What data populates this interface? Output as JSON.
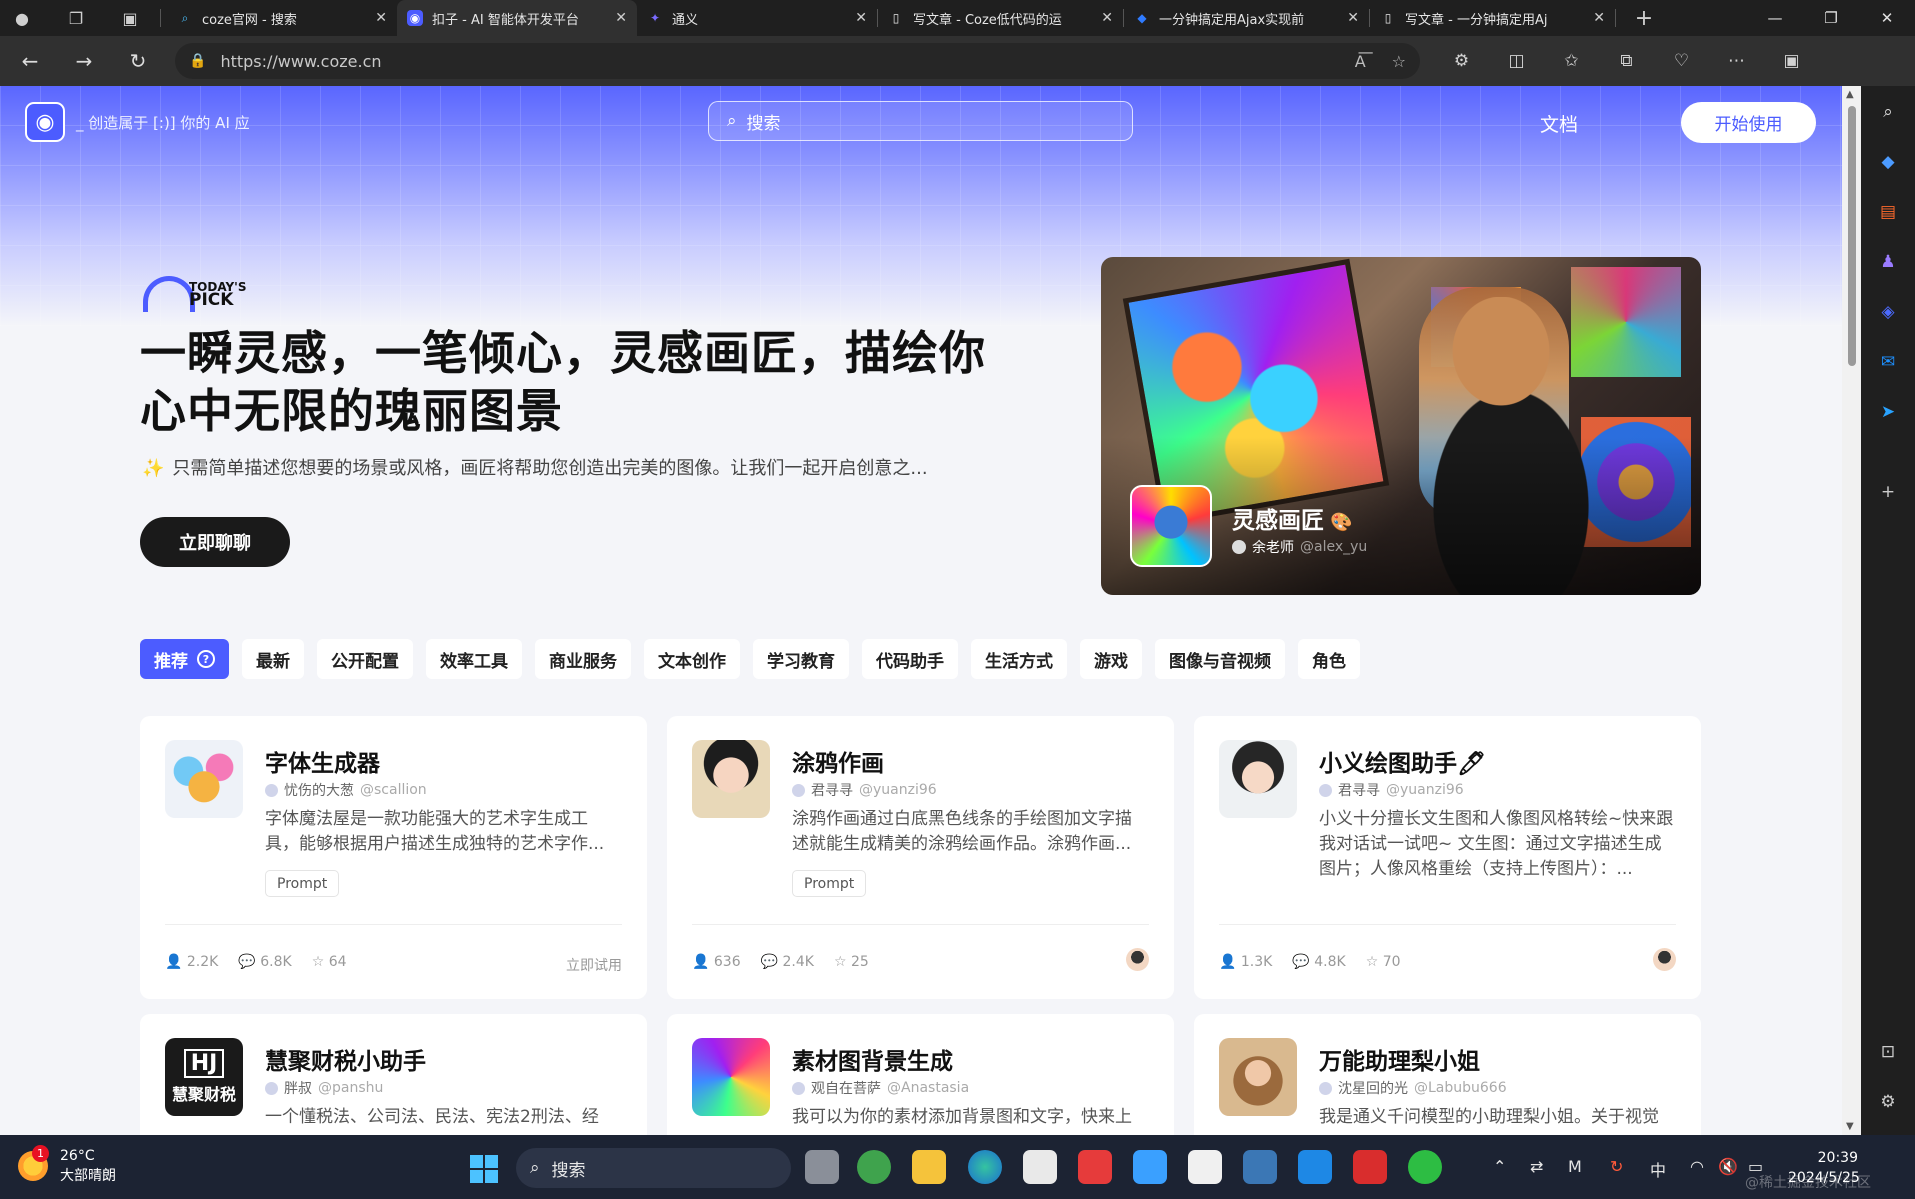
{
  "browser": {
    "tabs": [
      {
        "label": "coze官网 - 搜索",
        "icon": "search-icon"
      },
      {
        "label": "扣子 - AI 智能体开发平台",
        "icon": "coze-icon",
        "active": true
      },
      {
        "label": "通义",
        "icon": "tongyi-icon"
      },
      {
        "label": "写文章 - Coze低代码的运",
        "icon": "document-icon"
      },
      {
        "label": "一分钟搞定用Ajax实现前",
        "icon": "juejin-icon"
      },
      {
        "label": "写文章 - 一分钟搞定用Aj",
        "icon": "document-icon"
      }
    ],
    "url": "https://www.coze.cn"
  },
  "header": {
    "logo_text": "_ 创造属于 [:)] 你的 AI 应",
    "search_placeholder": "搜索",
    "docs_link": "文档",
    "start_button": "开始使用"
  },
  "hero": {
    "pick_small": "TODAY'S",
    "pick_big": "PICK",
    "title": "一瞬灵感，一笔倾心，灵感画匠，描绘你心中无限的瑰丽图景",
    "subtitle": "只需简单描述您想要的场景或风格，画匠将帮助您创造出完美的图像。让我们一起开启创意之...",
    "subtitle_icon": "✨",
    "chat_button": "立即聊聊",
    "bot_name": "灵感画匠",
    "bot_emoji": "🎨",
    "bot_author": "余老师",
    "bot_handle": "@alex_yu"
  },
  "categories": [
    "推荐",
    "最新",
    "公开配置",
    "效率工具",
    "商业服务",
    "文本创作",
    "学习教育",
    "代码助手",
    "生活方式",
    "游戏",
    "图像与音视频",
    "角色"
  ],
  "cards": [
    {
      "title": "字体生成器",
      "author": "忧伤的大葱",
      "handle": "@scallion",
      "desc": "字体魔法屋是一款功能强大的艺术字生成工具，能够根据用户描述生成独特的艺术字作...",
      "tag": "Prompt",
      "users": "2.2K",
      "chats": "6.8K",
      "stars": "64",
      "try": "立即试用"
    },
    {
      "title": "涂鸦作画",
      "author": "君寻寻",
      "handle": "@yuanzi96",
      "desc": "涂鸦作画通过白底黑色线条的手绘图加文字描述就能生成精美的涂鸦绘画作品。涂鸦作画...",
      "tag": "Prompt",
      "users": "636",
      "chats": "2.4K",
      "stars": "25"
    },
    {
      "title": "小义绘图助手🖊",
      "author": "君寻寻",
      "handle": "@yuanzi96",
      "desc": "小义十分擅长文生图和人像图风格转绘~快来跟我对话试一试吧~ 文生图：通过文字描述生成图片；人像风格重绘（支持上传图片）：...",
      "users": "1.3K",
      "chats": "4.8K",
      "stars": "70"
    },
    {
      "title": "慧聚财税小助手",
      "author": "胖叔",
      "handle": "@panshu",
      "desc": "一个懂税法、公司法、民法、宪法2刑法、经"
    },
    {
      "title": "素材图背景生成",
      "author": "观自在菩萨",
      "handle": "@Anastasia",
      "desc": "我可以为你的素材添加背景图和文字，快来上"
    },
    {
      "title": "万能助理梨小姐",
      "author": "沈星回的光",
      "handle": "@Labubu666",
      "desc": "我是通义千问模型的小助理梨小姐。关于视觉"
    }
  ],
  "card4_logo": {
    "top": "HJ",
    "bottom": "慧聚财税"
  },
  "taskbar": {
    "temp": "26°C",
    "weather": "大部晴朗",
    "badge": "1",
    "search": "搜索",
    "ime": "中",
    "time": "20:39",
    "date": "2024/5/25",
    "watermark": "@稀土掘金技术社区"
  },
  "colors": {
    "brand": "#4c5cff",
    "chrome": "#1f1f1f",
    "taskbar": "#1c2333"
  }
}
